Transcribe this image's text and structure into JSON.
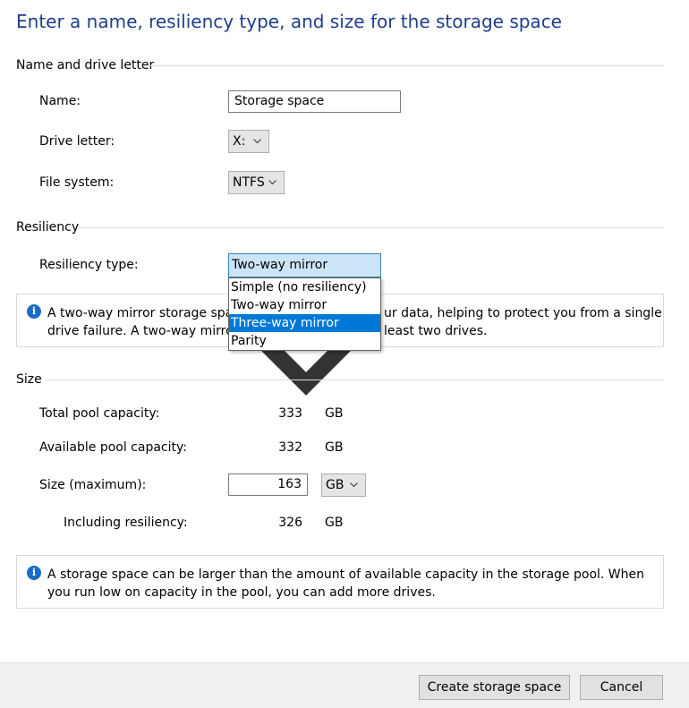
{
  "page_title": "Enter a name, resiliency type, and size for the storage space",
  "sections": {
    "name_drive": {
      "title": "Name and drive letter",
      "name_label": "Name:",
      "name_value": "Storage space",
      "drive_label": "Drive letter:",
      "drive_value": "X:",
      "fs_label": "File system:",
      "fs_value": "NTFS"
    },
    "resiliency": {
      "title": "Resiliency",
      "type_label": "Resiliency type:",
      "type_value": "Two-way mirror",
      "options": [
        "Simple (no resiliency)",
        "Two-way mirror",
        "Three-way mirror",
        "Parity"
      ],
      "highlighted_option": "Three-way mirror",
      "info_line1_left": "A two-way mirror storage spac",
      "info_line1_right": "ur data, helping to protect you from a single",
      "info_line2_left": "drive failure. A two-way mirror",
      "info_line2_right": "least two drives."
    },
    "size": {
      "title": "Size",
      "total_label": "Total pool capacity:",
      "total_value": "333",
      "total_unit": "GB",
      "available_label": "Available pool capacity:",
      "available_value": "332",
      "available_unit": "GB",
      "size_label": "Size (maximum):",
      "size_value": "163",
      "size_unit": "GB",
      "including_label": "Including resiliency:",
      "including_value": "326",
      "including_unit": "GB",
      "info_text": "A storage space can be larger than the amount of available capacity in the storage pool. When you run low on capacity in the pool, you can add more drives."
    }
  },
  "buttons": {
    "create": "Create storage space",
    "cancel": "Cancel"
  },
  "colors": {
    "title": "#1e3e8c",
    "highlight": "#0078d7",
    "info_icon": "#1a6dc7"
  },
  "icons": {
    "info": "info-icon",
    "dropdown": "chevron-down-icon"
  }
}
